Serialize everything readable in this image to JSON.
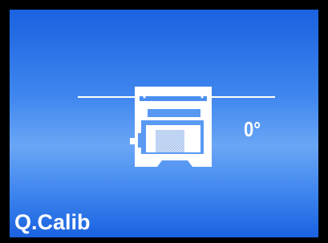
{
  "screen": {
    "title": "Q.Calib",
    "angle": "0°",
    "device_icon": "printer-level-icon",
    "colors": {
      "background_top": "#1a62e0",
      "background_mid": "#6aa6f6",
      "bezel": "#000000",
      "foreground": "#ffffff"
    }
  }
}
